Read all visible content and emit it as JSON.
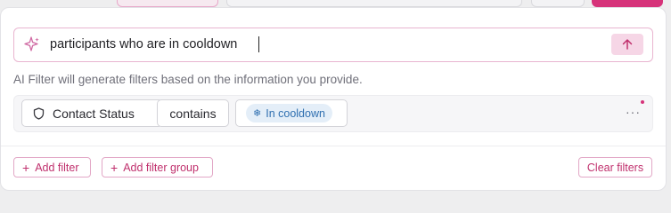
{
  "ai_filter": {
    "query": "participants who are in cooldown",
    "helper_text": "AI Filter will generate filters based on the information you provide."
  },
  "filter": {
    "field": "Contact Status",
    "operator": "contains",
    "value": "In cooldown"
  },
  "actions": {
    "add_filter": "Add filter",
    "add_filter_group": "Add filter group",
    "clear_filters": "Clear filters"
  },
  "icons": {
    "sparkle": "sparkle-icon",
    "send": "arrow-up-icon",
    "shield": "shield-icon",
    "snowflake": "snowflake-icon",
    "more": "more-horizontal-icon",
    "plus": "plus-icon"
  },
  "colors": {
    "accent": "#d6337a",
    "accent_light": "#f6d6e6",
    "badge_bg": "#e4eef8",
    "badge_text": "#2f6fb0"
  }
}
